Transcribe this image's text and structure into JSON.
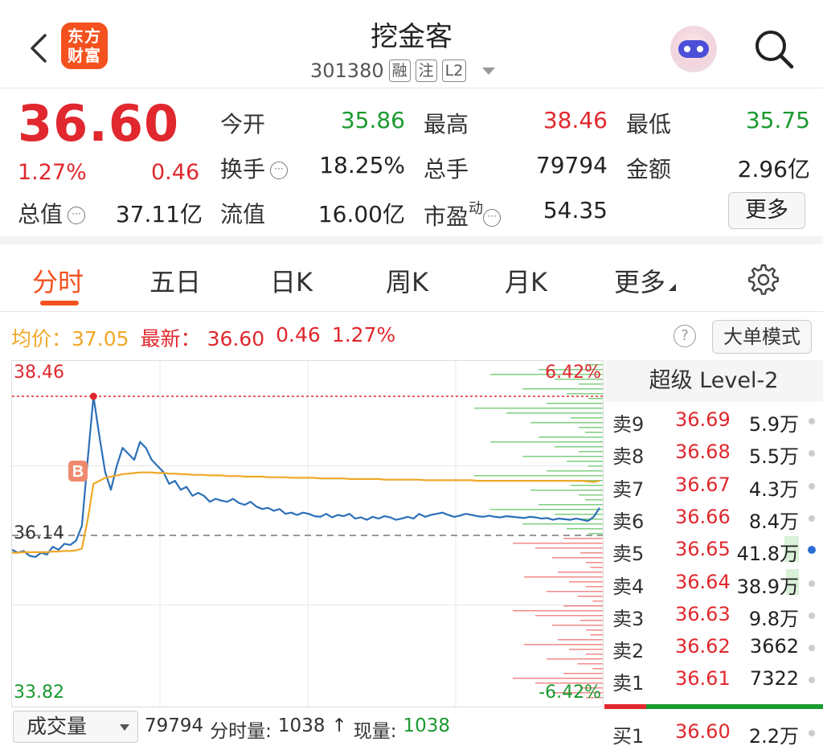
{
  "header": {
    "title": "挖金客",
    "code": "301380",
    "tags": [
      "融",
      "注",
      "L2"
    ],
    "logo_text": "东方财富"
  },
  "quote": {
    "price": "36.60",
    "pct": "1.27%",
    "change": "0.46",
    "open_label": "今开",
    "open": "35.86",
    "high_label": "最高",
    "high": "38.46",
    "low_label": "最低",
    "low": "35.75",
    "turnover_label": "换手",
    "turnover": "18.25%",
    "volume_label": "总手",
    "volume": "79794",
    "amount_label": "金额",
    "amount": "2.96亿",
    "mcap_label": "总值",
    "mcap": "37.11亿",
    "float_label": "流值",
    "float": "16.00亿",
    "pe_label": "市盈",
    "pe_sup": "动",
    "pe": "54.35",
    "more": "更多"
  },
  "tabs": [
    "分时",
    "五日",
    "日K",
    "周K",
    "月K",
    "更多"
  ],
  "infoline": {
    "avg_label": "均价：",
    "avg": "37.05",
    "latest_label": "最新：",
    "latest": "36.60",
    "latest_chg": "0.46",
    "latest_pct": "1.27%",
    "help": "?",
    "big_mode": "大单模式"
  },
  "chart_data": {
    "type": "line",
    "title": "",
    "xlabel": "",
    "ylabel": "",
    "ylim": [
      33.82,
      38.46
    ],
    "ytick_labels": {
      "top": "38.46",
      "mid": "36.14",
      "bottom": "33.82",
      "top_pct": "6.42%",
      "bottom_pct": "-6.42%"
    },
    "prev_close": 36.14,
    "day_high": 38.46,
    "buy_marker": "B",
    "series": [
      {
        "name": "最新",
        "color": "#2c6fb8",
        "values": [
          35.9,
          35.85,
          35.88,
          35.8,
          35.78,
          35.85,
          35.82,
          35.95,
          35.9,
          36.0,
          35.98,
          36.05,
          36.3,
          37.4,
          38.46,
          37.8,
          37.2,
          36.9,
          37.3,
          37.6,
          37.5,
          37.4,
          37.7,
          37.6,
          37.4,
          37.3,
          37.2,
          37.0,
          37.05,
          36.9,
          36.95,
          36.8,
          36.85,
          36.8,
          36.7,
          36.75,
          36.72,
          36.7,
          36.75,
          36.68,
          36.65,
          36.7,
          36.62,
          36.58,
          36.6,
          36.55,
          36.58,
          36.5,
          36.52,
          36.48,
          36.52,
          36.5,
          36.46,
          36.45,
          36.5,
          36.44,
          36.48,
          36.46,
          36.5,
          36.42,
          36.44,
          36.4,
          36.45,
          36.42,
          36.46,
          36.44,
          36.4,
          36.42,
          36.45,
          36.42,
          36.5,
          36.45,
          36.48,
          36.5,
          36.52,
          36.48,
          36.45,
          36.47,
          36.5,
          36.48,
          36.46,
          36.45,
          36.47,
          36.45,
          36.44,
          36.46,
          36.45,
          36.44,
          36.43,
          36.45,
          36.44,
          36.42,
          36.43,
          36.4,
          36.42,
          36.41,
          36.4,
          36.42,
          36.4,
          36.38,
          36.45,
          36.6
        ]
      },
      {
        "name": "均价",
        "color": "#f0a828",
        "values": [
          35.85,
          35.85,
          35.86,
          35.86,
          35.86,
          35.86,
          35.86,
          35.87,
          35.87,
          35.88,
          35.88,
          35.89,
          35.92,
          36.4,
          37.0,
          37.05,
          37.1,
          37.12,
          37.14,
          37.16,
          37.17,
          37.18,
          37.19,
          37.19,
          37.19,
          37.18,
          37.18,
          37.17,
          37.17,
          37.16,
          37.16,
          37.15,
          37.15,
          37.15,
          37.14,
          37.14,
          37.14,
          37.13,
          37.13,
          37.13,
          37.12,
          37.12,
          37.12,
          37.12,
          37.11,
          37.11,
          37.11,
          37.11,
          37.1,
          37.1,
          37.1,
          37.1,
          37.1,
          37.09,
          37.09,
          37.09,
          37.09,
          37.09,
          37.08,
          37.08,
          37.08,
          37.08,
          37.08,
          37.08,
          37.07,
          37.07,
          37.07,
          37.07,
          37.07,
          37.07,
          37.07,
          37.06,
          37.06,
          37.06,
          37.06,
          37.06,
          37.06,
          37.06,
          37.06,
          37.06,
          37.05,
          37.05,
          37.05,
          37.05,
          37.05,
          37.05,
          37.05,
          37.05,
          37.05,
          37.05,
          37.05,
          37.05,
          37.05,
          37.05,
          37.05,
          37.05,
          37.05,
          37.05,
          37.05,
          37.04,
          37.03,
          37.05
        ]
      }
    ]
  },
  "orderbook": {
    "title": "超级 Level-2",
    "rows": [
      {
        "label": "卖9",
        "price": "36.69",
        "vol": "5.9万"
      },
      {
        "label": "卖8",
        "price": "36.68",
        "vol": "5.5万"
      },
      {
        "label": "卖7",
        "price": "36.67",
        "vol": "4.3万"
      },
      {
        "label": "卖6",
        "price": "36.66",
        "vol": "8.4万"
      },
      {
        "label": "卖5",
        "price": "36.65",
        "vol": "41.8万"
      },
      {
        "label": "卖4",
        "price": "36.64",
        "vol": "38.9万"
      },
      {
        "label": "卖3",
        "price": "36.63",
        "vol": "9.8万"
      },
      {
        "label": "卖2",
        "price": "36.62",
        "vol": "3662"
      },
      {
        "label": "卖1",
        "price": "36.61",
        "vol": "7322"
      },
      {
        "label": "买1",
        "price": "36.60",
        "vol": "2.2万"
      }
    ]
  },
  "bottom": {
    "select": "成交量",
    "total": "79794",
    "min_vol_label": "分时量:",
    "min_vol": "1038",
    "arrow": "↑",
    "now_label": "现量:",
    "now": "1038"
  },
  "colors": {
    "up": "#e0282e",
    "down": "#1b9a2f",
    "brand": "#f4511e",
    "avg": "#f0a828",
    "line": "#2c6fb8"
  }
}
